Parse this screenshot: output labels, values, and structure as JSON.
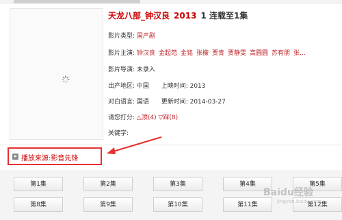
{
  "movie": {
    "title": "天龙八部_钟汉良",
    "year": "2013",
    "status": "1  连载至1集",
    "type_label": "影片类型:",
    "type_value": "国产剧",
    "actors_label": "影片主演:",
    "actors": [
      "钟汉良",
      "金起范",
      "金铭",
      "张檬",
      "贾青",
      "贾静雯",
      "高圆圆",
      "苏有朋",
      "张…"
    ],
    "director_label": "影片导演:",
    "director_value": "未录入",
    "region_label": "出产地区:",
    "region_value": "中国",
    "release_label": "上映时间:",
    "release_value": "2013",
    "language_label": "对白语言:",
    "language_value": "国语",
    "update_label": "更新时间:",
    "update_value": "2014-03-27",
    "rating_label": "请您打分:",
    "up_vote": "顶(4)",
    "down_vote": "踩(8)",
    "keywords_label": "关键字:"
  },
  "source": {
    "label": "播放来源:影音先锋"
  },
  "episodes": [
    "第1集",
    "第2集",
    "第3集",
    "第4集",
    "第5集",
    "第8集",
    "第9集",
    "第10集",
    "第11集",
    "第12集"
  ],
  "watermark": {
    "main": "Baidu经验",
    "sub": "jingyan.baidu.com"
  },
  "colors": {
    "accent_red": "#c0262c",
    "highlight_border": "#e53030"
  }
}
